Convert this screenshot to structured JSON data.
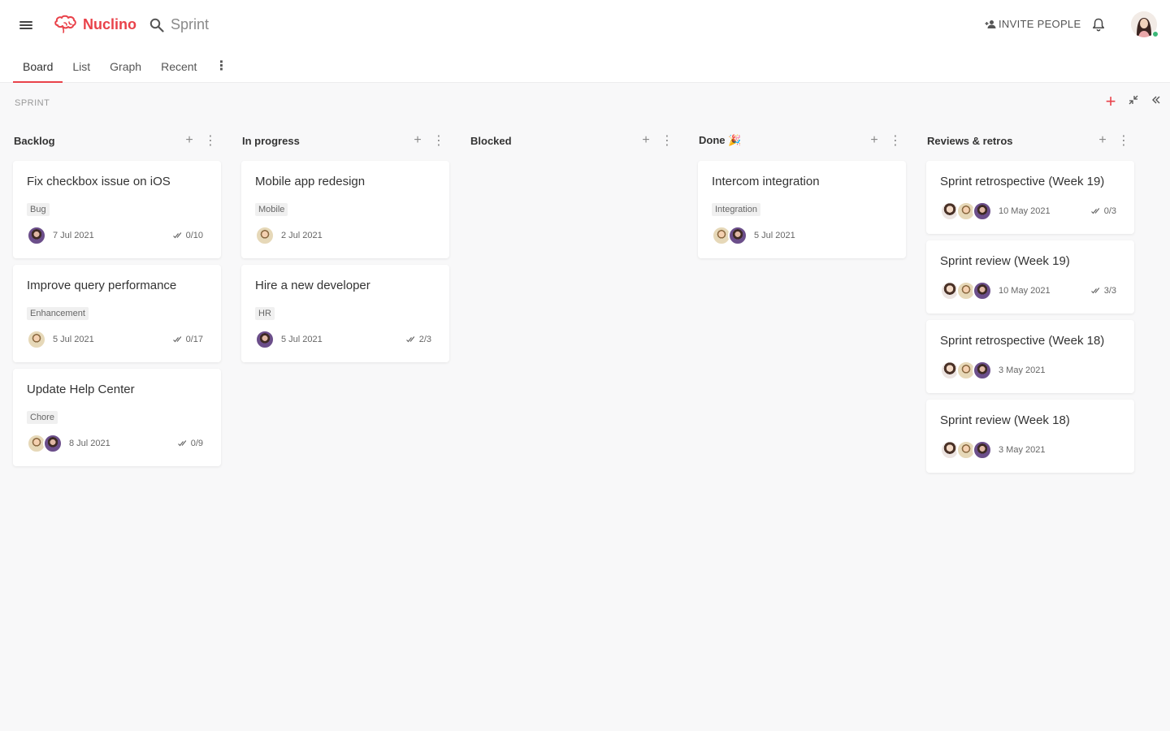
{
  "app": {
    "name": "Nuclino"
  },
  "search": {
    "placeholder": "Sprint"
  },
  "header": {
    "invite_label": "INVITE PEOPLE"
  },
  "tabs": [
    {
      "label": "Board"
    },
    {
      "label": "List"
    },
    {
      "label": "Graph"
    },
    {
      "label": "Recent"
    }
  ],
  "board": {
    "label": "SPRINT"
  },
  "colors": {
    "brand": "#e9424a"
  },
  "columns": [
    {
      "title": "Backlog",
      "cards": [
        {
          "title": "Fix checkbox issue on iOS",
          "tag": "Bug",
          "date": "7 Jul 2021",
          "checklist": "0/10",
          "avatars": [
            "violet"
          ]
        },
        {
          "title": "Improve query performance",
          "tag": "Enhancement",
          "date": "5 Jul 2021",
          "checklist": "0/17",
          "avatars": [
            "man"
          ]
        },
        {
          "title": "Update Help Center",
          "tag": "Chore",
          "date": "8 Jul 2021",
          "checklist": "0/9",
          "avatars": [
            "man",
            "violet"
          ]
        }
      ]
    },
    {
      "title": "In progress",
      "cards": [
        {
          "title": "Mobile app redesign",
          "tag": "Mobile",
          "date": "2 Jul 2021",
          "checklist": "",
          "avatars": [
            "man"
          ]
        },
        {
          "title": "Hire a new developer",
          "tag": "HR",
          "date": "5 Jul 2021",
          "checklist": "2/3",
          "avatars": [
            "violet"
          ]
        }
      ]
    },
    {
      "title": "Blocked",
      "cards": []
    },
    {
      "title": "Done",
      "title_emoji": "🎉",
      "cards": [
        {
          "title": "Intercom integration",
          "tag": "Integration",
          "date": "5 Jul 2021",
          "checklist": "",
          "avatars": [
            "man",
            "violet"
          ]
        }
      ]
    },
    {
      "title": "Reviews & retros",
      "cards": [
        {
          "title": "Sprint retrospective (Week 19)",
          "tag": "",
          "date": "10 May 2021",
          "checklist": "0/3",
          "avatars": [
            "woman",
            "man",
            "violet"
          ]
        },
        {
          "title": "Sprint review (Week 19)",
          "tag": "",
          "date": "10 May 2021",
          "checklist": "3/3",
          "avatars": [
            "woman",
            "man",
            "violet"
          ]
        },
        {
          "title": "Sprint retrospective (Week 18)",
          "tag": "",
          "date": "3 May 2021",
          "checklist": "",
          "avatars": [
            "woman",
            "man",
            "violet"
          ]
        },
        {
          "title": "Sprint review (Week 18)",
          "tag": "",
          "date": "3 May 2021",
          "checklist": "",
          "avatars": [
            "woman",
            "man",
            "violet"
          ]
        }
      ]
    }
  ]
}
